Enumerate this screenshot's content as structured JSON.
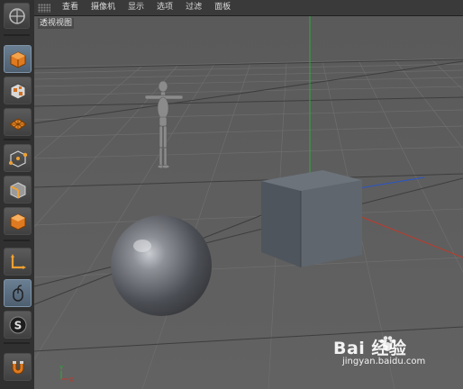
{
  "menubar": {
    "items": [
      "查看",
      "摄像机",
      "显示",
      "选项",
      "过滤",
      "面板"
    ]
  },
  "viewport": {
    "label": "透视视图",
    "background": "#5c5c5c",
    "axis_labels": {
      "y": "Y",
      "x": "X"
    }
  },
  "toolbar": {
    "buttons": [
      {
        "name": "move-object-icon",
        "active": false
      },
      {
        "name": "model-mode-icon",
        "active": true
      },
      {
        "name": "texture-mode-icon",
        "active": false
      },
      {
        "name": "workplane-icon",
        "active": false
      },
      {
        "name": "points-mode-icon",
        "active": false
      },
      {
        "name": "edges-mode-icon",
        "active": false
      },
      {
        "name": "polygons-mode-icon",
        "active": false
      },
      {
        "name": "axis-mode-icon",
        "active": false
      },
      {
        "name": "tweak-mode-icon",
        "active": true
      },
      {
        "name": "snap-icon",
        "active": false
      },
      {
        "name": "magnet-icon",
        "active": false
      }
    ]
  },
  "watermark": {
    "brand": "Bai 经验",
    "url": "jingyan.baidu.com"
  },
  "colors": {
    "accent_active": "#6b7f93",
    "y_axis": "#2faa3a",
    "x_axis": "#c0392b",
    "z_axis": "#2a55c8"
  }
}
